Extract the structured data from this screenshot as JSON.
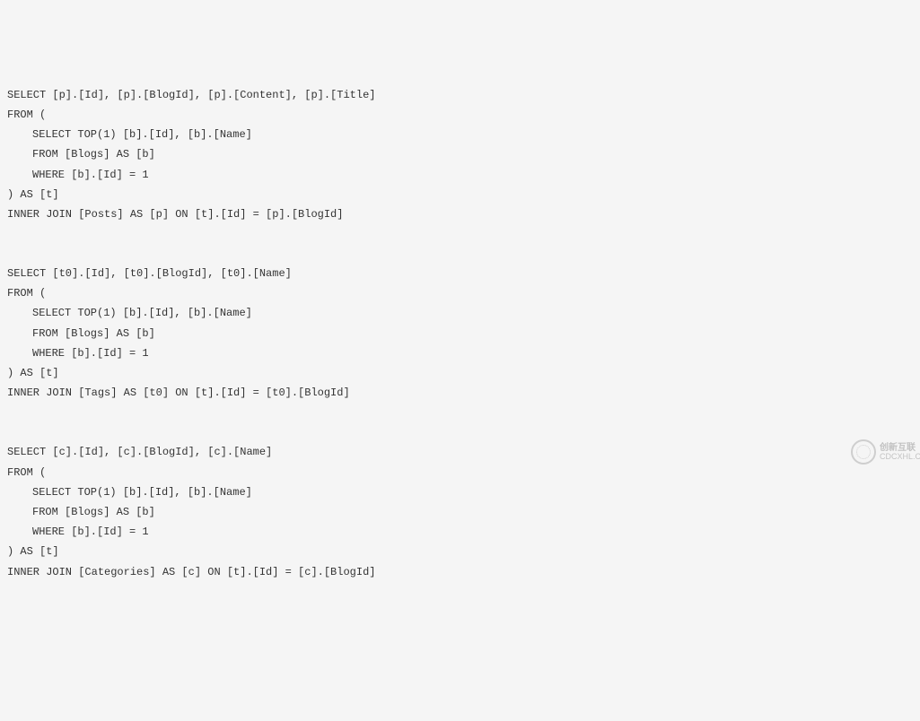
{
  "lines": [
    {
      "text": "SELECT [p].[Id], [p].[BlogId], [p].[Content], [p].[Title]",
      "indent": 0
    },
    {
      "text": "FROM (",
      "indent": 0
    },
    {
      "text": "SELECT TOP(1) [b].[Id], [b].[Name]",
      "indent": 1
    },
    {
      "text": "FROM [Blogs] AS [b]",
      "indent": 1
    },
    {
      "text": "WHERE [b].[Id] = 1",
      "indent": 1
    },
    {
      "text": ") AS [t]",
      "indent": 0
    },
    {
      "text": "INNER JOIN [Posts] AS [p] ON [t].[Id] = [p].[BlogId]",
      "indent": 0
    },
    {
      "blank": true
    },
    {
      "blank": true
    },
    {
      "text": "SELECT [t0].[Id], [t0].[BlogId], [t0].[Name]",
      "indent": 0
    },
    {
      "text": "FROM (",
      "indent": 0
    },
    {
      "text": "SELECT TOP(1) [b].[Id], [b].[Name]",
      "indent": 1
    },
    {
      "text": "FROM [Blogs] AS [b]",
      "indent": 1
    },
    {
      "text": "WHERE [b].[Id] = 1",
      "indent": 1
    },
    {
      "text": ") AS [t]",
      "indent": 0
    },
    {
      "text": "INNER JOIN [Tags] AS [t0] ON [t].[Id] = [t0].[BlogId]",
      "indent": 0
    },
    {
      "blank": true
    },
    {
      "blank": true
    },
    {
      "text": "SELECT [c].[Id], [c].[BlogId], [c].[Name]",
      "indent": 0
    },
    {
      "text": "FROM (",
      "indent": 0
    },
    {
      "text": "SELECT TOP(1) [b].[Id], [b].[Name]",
      "indent": 1
    },
    {
      "text": "FROM [Blogs] AS [b]",
      "indent": 1
    },
    {
      "text": "WHERE [b].[Id] = 1",
      "indent": 1
    },
    {
      "text": ") AS [t]",
      "indent": 0
    },
    {
      "text": "INNER JOIN [Categories] AS [c] ON [t].[Id] = [c].[BlogId]",
      "indent": 0
    }
  ],
  "watermark": {
    "brand_cn": "创新互联",
    "brand_sub": "CDCXHL.COM"
  }
}
